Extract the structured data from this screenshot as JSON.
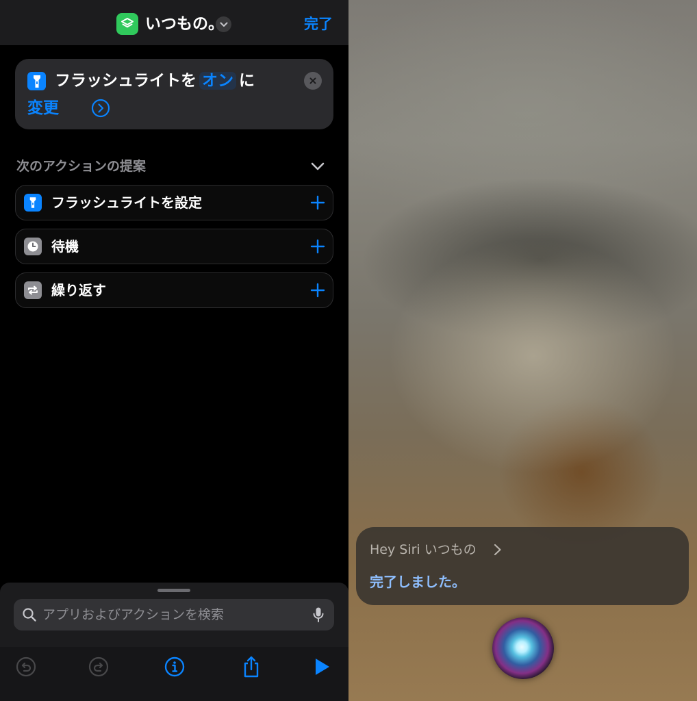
{
  "shortcut": {
    "title": "いつもの。",
    "done_label": "完了"
  },
  "action_card": {
    "text_before": "フラッシュライトを",
    "param_value": "オン",
    "text_after": "に",
    "line2": "変更"
  },
  "suggestions": {
    "header": "次のアクションの提案",
    "items": [
      {
        "label": "フラッシュライトを設定",
        "icon": "flashlight-icon",
        "color": "#0a84ff"
      },
      {
        "label": "待機",
        "icon": "clock-icon",
        "color": "#8e8e93"
      },
      {
        "label": "繰り返す",
        "icon": "repeat-icon",
        "color": "#8e8e93"
      }
    ]
  },
  "search": {
    "placeholder": "アプリおよびアクションを検索"
  },
  "toolbar": {
    "buttons": [
      "undo-icon",
      "redo-icon",
      "info-icon",
      "share-icon",
      "play-icon"
    ]
  },
  "siri": {
    "query": "Hey Siri いつもの",
    "response": "完了しました。"
  },
  "colors": {
    "accent": "#0a84ff",
    "shortcuts_green": "#30c95c"
  }
}
